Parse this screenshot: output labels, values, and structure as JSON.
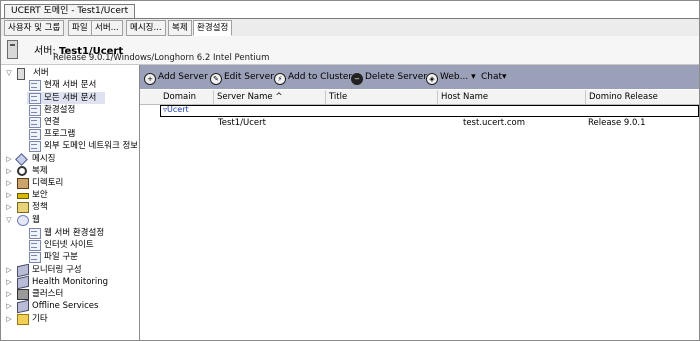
{
  "window_tab": "UCERT 도메인 - Test1/Ucert",
  "tabs": [
    "사용자 및 그룹",
    "파일",
    "서버...",
    "메시징...",
    "복제",
    "환경설정"
  ],
  "header": {
    "title_prefix": "서버:",
    "title_name": "Test1/Ucert",
    "subtitle": "Release 9.0.1/Windows/Longhorn 6.2 Intel Pentium"
  },
  "nav": {
    "items": [
      {
        "label": "서버",
        "icon": "server-icon",
        "twisty": "▽"
      },
      {
        "label": "현재 서버 문서",
        "icon": "document-icon"
      },
      {
        "label": "모든 서버 문서",
        "icon": "document-icon",
        "selected": true
      },
      {
        "label": "환경설정",
        "icon": "document-icon"
      },
      {
        "label": "연결",
        "icon": "document-icon"
      },
      {
        "label": "프로그램",
        "icon": "document-icon"
      },
      {
        "label": "외부 도메인 네트워크 정보",
        "icon": "document-icon"
      },
      {
        "label": "메시징",
        "icon": "messaging-icon",
        "twisty": "▷"
      },
      {
        "label": "복제",
        "icon": "replication-icon",
        "twisty": "▷"
      },
      {
        "label": "디렉토리",
        "icon": "directory-icon",
        "twisty": "▷"
      },
      {
        "label": "보안",
        "icon": "key-icon",
        "twisty": "▷"
      },
      {
        "label": "정책",
        "icon": "policy-icon",
        "twisty": "▷"
      },
      {
        "label": "웹",
        "icon": "web-icon",
        "twisty": "▽"
      },
      {
        "label": "웹 서버 환경설정",
        "icon": "document-icon"
      },
      {
        "label": "인터넷 사이트",
        "icon": "document-icon"
      },
      {
        "label": "파일 구분",
        "icon": "document-icon"
      },
      {
        "label": "모니터링 구성",
        "icon": "book-icon",
        "twisty": "▷"
      },
      {
        "label": "Health Monitoring",
        "icon": "book-icon",
        "twisty": "▷"
      },
      {
        "label": "클러스터",
        "icon": "cluster-icon",
        "twisty": "▷"
      },
      {
        "label": "Offline Services",
        "icon": "book-icon",
        "twisty": "▷"
      },
      {
        "label": "기타",
        "icon": "folder-icon",
        "twisty": "▷"
      }
    ]
  },
  "toolbar": {
    "add_server": "Add Server",
    "edit_server": "Edit Server",
    "add_to_cluster": "Add to Cluster",
    "delete_server": "Delete Server",
    "web": "Web...",
    "chat": "Chat"
  },
  "grid": {
    "columns": [
      "Domain",
      "Server Name ^",
      "Title",
      "Host Name",
      "Domino Release"
    ],
    "category": "Ucert",
    "rows": [
      {
        "domain": "",
        "server_name": "Test1/Ucert",
        "title": "",
        "host_name": "test.ucert.com",
        "release": "Release 9.0.1"
      }
    ]
  },
  "colors": {
    "toolbar_bg": "#9aa0b8",
    "selected_bg": "#dfe2f0",
    "category_text": "#1a3ab0"
  }
}
